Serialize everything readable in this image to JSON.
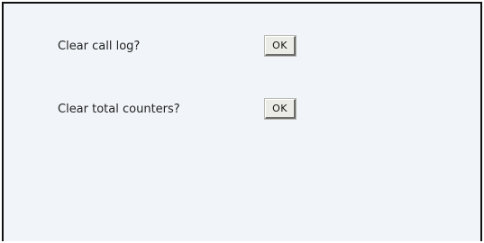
{
  "actions": [
    {
      "label": "Clear call log?",
      "button_label": "OK"
    },
    {
      "label": "Clear total counters?",
      "button_label": "OK"
    }
  ]
}
